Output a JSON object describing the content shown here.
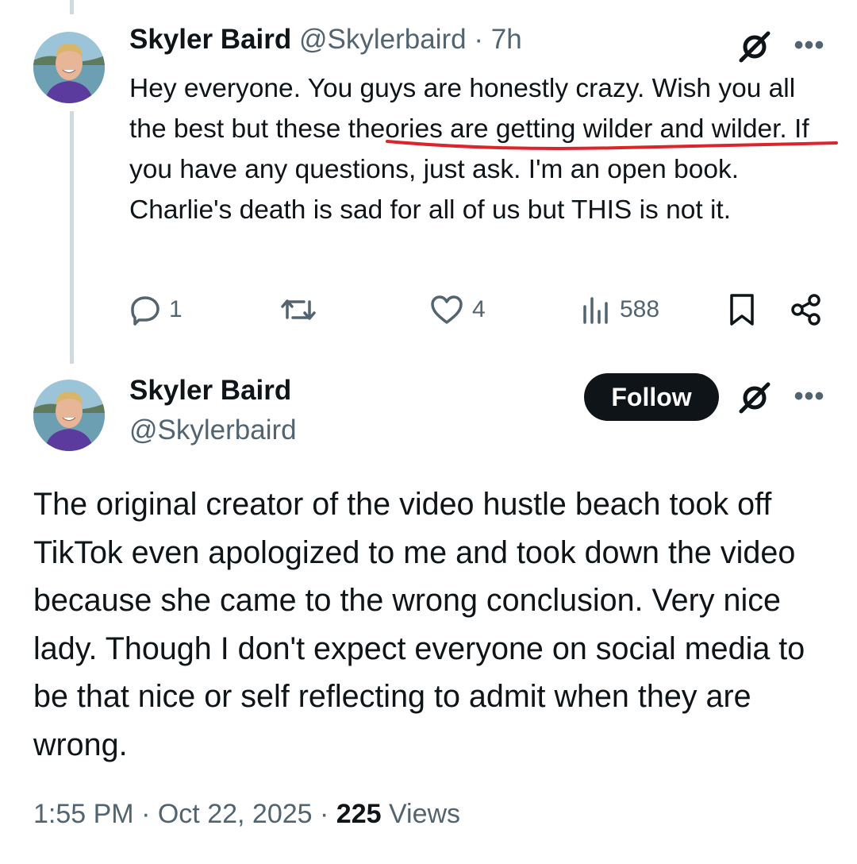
{
  "reply": {
    "display_name": "Skyler Baird",
    "handle": "@Skylerbaird",
    "separator": "·",
    "time_ago": "7h",
    "text": "Hey everyone. You guys are honestly crazy. Wish you all the best but these theories are getting wilder and wilder. If you have any questions, just ask. I'm an open book. Charlie's death is sad for all of us but THIS is not it.",
    "more_label": "•••",
    "stats": {
      "replies": "1",
      "reposts": "",
      "likes": "4",
      "views": "588"
    }
  },
  "main": {
    "display_name": "Skyler Baird",
    "handle": "@Skylerbaird",
    "follow_label": "Follow",
    "more_label": "•••",
    "text": "The original creator of the video hustle beach took off TikTok even apologized to me and took down the video because she came to the wrong conclusion. Very nice lady. Though I don't expect everyone on social media to be that nice or self reflecting to admit when they are wrong.",
    "time": "1:55 PM",
    "separator": "·",
    "date": "Oct 22, 2025",
    "separator2": "·",
    "view_count": "225",
    "views_label": "Views"
  },
  "icons": {
    "grok": "grok-icon",
    "more": "more-icon",
    "reply": "reply-icon",
    "repost": "repost-icon",
    "like": "heart-icon",
    "views": "views-icon",
    "bookmark": "bookmark-icon",
    "share": "share-icon"
  },
  "colors": {
    "text": "#0f1419",
    "secondary": "#536471",
    "thread_line": "#cfd9de",
    "follow_bg": "#0f1419",
    "annotation": "#d9252b"
  }
}
